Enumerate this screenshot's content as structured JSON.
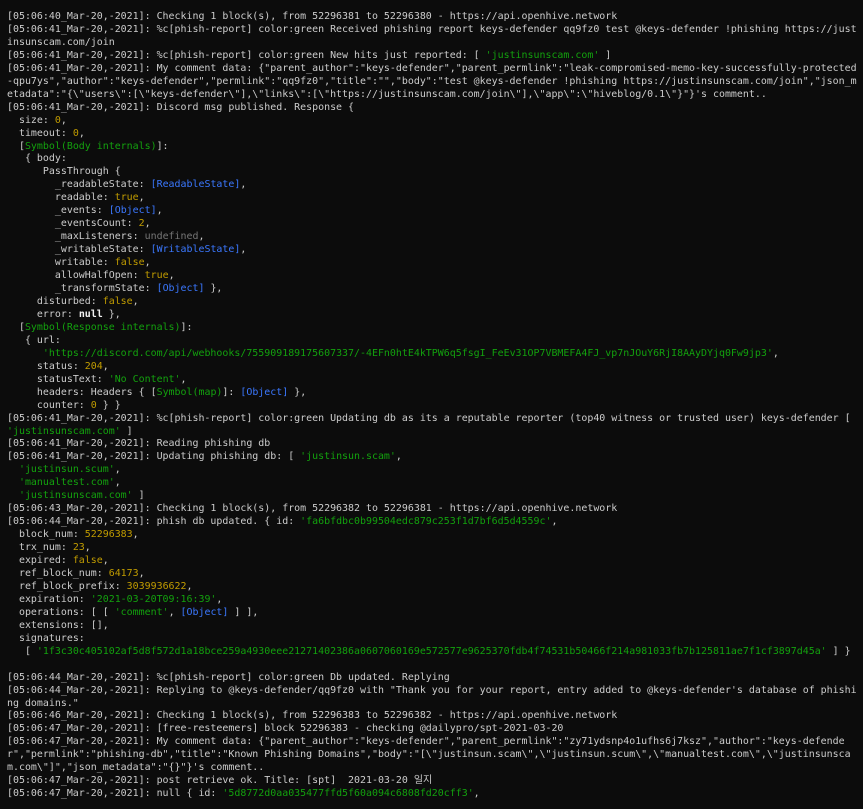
{
  "window": {
    "type": "terminal"
  },
  "colors": {
    "background": "#0c0c0c",
    "default": "#cccccc",
    "string": "#13a10e",
    "number": "#c19c00",
    "special": "#3b78ff",
    "symbol_ref": "#61d6d6",
    "bold": "#f2f2f2",
    "undefined": "#767676"
  },
  "lines": [
    [
      {
        "t": "[05:06:40_Mar-20,-2021]: Checking 1 block(s), from 52296381 to 52296380 - https://api.openhive.network",
        "c": "d"
      }
    ],
    [
      {
        "t": "[05:06:41_Mar-20,-2021]: %c[phish-report] color:green Received phishing report keys-defender qq9fz0 test @keys-defender !phishing https://justinsunscam.com/join",
        "c": "d"
      }
    ],
    [
      {
        "t": "[05:06:41_Mar-20,-2021]: %c[phish-report] color:green New hits just reported: [ ",
        "c": "d"
      },
      {
        "t": "'justinsunscam.com'",
        "c": "g"
      },
      {
        "t": " ]",
        "c": "d"
      }
    ],
    [
      {
        "t": "[05:06:41_Mar-20,-2021]: My comment data: {\"parent_author\":\"keys-defender\",\"parent_permlink\":\"leak-compromised-memo-key-successfully-protected-qpu7ys\",\"author\":\"keys-defender\",\"permlink\":\"qq9fz0\",\"title\":\"\",\"body\":\"test @keys-defender !phishing https://justinsunscam.com/join\",\"json_metadata\":\"{\\\"users\\\":[\\\"keys-defender\\\"],\\\"links\\\":[\\\"https://justinsunscam.com/join\\\"],\\\"app\\\":\\\"hiveblog/0.1\\\"}\"}'s comment..",
        "c": "d"
      }
    ],
    [
      {
        "t": "[05:06:41_Mar-20,-2021]: Discord msg published. Response {",
        "c": "d"
      }
    ],
    [
      {
        "t": "  size: ",
        "c": "d"
      },
      {
        "t": "0",
        "c": "y"
      },
      {
        "t": ",",
        "c": "d"
      }
    ],
    [
      {
        "t": "  timeout: ",
        "c": "d"
      },
      {
        "t": "0",
        "c": "y"
      },
      {
        "t": ",",
        "c": "d"
      }
    ],
    [
      {
        "t": "  [",
        "c": "d"
      },
      {
        "t": "Symbol(Body internals)",
        "c": "g"
      },
      {
        "t": "]:",
        "c": "d"
      }
    ],
    [
      {
        "t": "   { body:",
        "c": "d"
      }
    ],
    [
      {
        "t": "      PassThrough {",
        "c": "d"
      }
    ],
    [
      {
        "t": "        _readableState: ",
        "c": "d"
      },
      {
        "t": "[ReadableState]",
        "c": "c"
      },
      {
        "t": ",",
        "c": "d"
      }
    ],
    [
      {
        "t": "        readable: ",
        "c": "d"
      },
      {
        "t": "true",
        "c": "y"
      },
      {
        "t": ",",
        "c": "d"
      }
    ],
    [
      {
        "t": "        _events: ",
        "c": "d"
      },
      {
        "t": "[Object]",
        "c": "c"
      },
      {
        "t": ",",
        "c": "d"
      }
    ],
    [
      {
        "t": "        _eventsCount: ",
        "c": "d"
      },
      {
        "t": "2",
        "c": "y"
      },
      {
        "t": ",",
        "c": "d"
      }
    ],
    [
      {
        "t": "        _maxListeners: ",
        "c": "d"
      },
      {
        "t": "undefined",
        "c": "u"
      },
      {
        "t": ",",
        "c": "d"
      }
    ],
    [
      {
        "t": "        _writableState: ",
        "c": "d"
      },
      {
        "t": "[WritableState]",
        "c": "c"
      },
      {
        "t": ",",
        "c": "d"
      }
    ],
    [
      {
        "t": "        writable: ",
        "c": "d"
      },
      {
        "t": "false",
        "c": "y"
      },
      {
        "t": ",",
        "c": "d"
      }
    ],
    [
      {
        "t": "        allowHalfOpen: ",
        "c": "d"
      },
      {
        "t": "true",
        "c": "y"
      },
      {
        "t": ",",
        "c": "d"
      }
    ],
    [
      {
        "t": "        _transformState: ",
        "c": "d"
      },
      {
        "t": "[Object]",
        "c": "c"
      },
      {
        "t": " },",
        "c": "d"
      }
    ],
    [
      {
        "t": "     disturbed: ",
        "c": "d"
      },
      {
        "t": "false",
        "c": "y"
      },
      {
        "t": ",",
        "c": "d"
      }
    ],
    [
      {
        "t": "     error: ",
        "c": "d"
      },
      {
        "t": "null",
        "c": "b"
      },
      {
        "t": " },",
        "c": "d"
      }
    ],
    [
      {
        "t": "  [",
        "c": "d"
      },
      {
        "t": "Symbol(Response internals)",
        "c": "g"
      },
      {
        "t": "]:",
        "c": "d"
      }
    ],
    [
      {
        "t": "   { url:",
        "c": "d"
      }
    ],
    [
      {
        "t": "      ",
        "c": "d"
      },
      {
        "t": "'https://discord.com/api/webhooks/755909189175607337/-4EFn0htE4kTPW6q5fsgI_FeEv31OP7VBMEFA4FJ_vp7nJOuY6RjI8AAyDYjq0Fw9jp3'",
        "c": "g"
      },
      {
        "t": ",",
        "c": "d"
      }
    ],
    [
      {
        "t": "     status: ",
        "c": "d"
      },
      {
        "t": "204",
        "c": "y"
      },
      {
        "t": ",",
        "c": "d"
      }
    ],
    [
      {
        "t": "     statusText: ",
        "c": "d"
      },
      {
        "t": "'No Content'",
        "c": "g"
      },
      {
        "t": ",",
        "c": "d"
      }
    ],
    [
      {
        "t": "     headers: Headers { [",
        "c": "d"
      },
      {
        "t": "Symbol(map)",
        "c": "g"
      },
      {
        "t": "]: ",
        "c": "d"
      },
      {
        "t": "[Object]",
        "c": "c"
      },
      {
        "t": " },",
        "c": "d"
      }
    ],
    [
      {
        "t": "     counter: ",
        "c": "d"
      },
      {
        "t": "0",
        "c": "y"
      },
      {
        "t": " } }",
        "c": "d"
      }
    ],
    [
      {
        "t": "[05:06:41_Mar-20,-2021]: %c[phish-report] color:green Updating db as its a reputable reporter (top40 witness or trusted user) keys-defender [ ",
        "c": "d"
      },
      {
        "t": "'justinsunscam.com'",
        "c": "g"
      },
      {
        "t": " ]",
        "c": "d"
      }
    ],
    [
      {
        "t": "[05:06:41_Mar-20,-2021]: Reading phishing db",
        "c": "d"
      }
    ],
    [
      {
        "t": "[05:06:41_Mar-20,-2021]: Updating phishing db: [ ",
        "c": "d"
      },
      {
        "t": "'justinsun.scam'",
        "c": "g"
      },
      {
        "t": ",",
        "c": "d"
      }
    ],
    [
      {
        "t": "  ",
        "c": "d"
      },
      {
        "t": "'justinsun.scum'",
        "c": "g"
      },
      {
        "t": ",",
        "c": "d"
      }
    ],
    [
      {
        "t": "  ",
        "c": "d"
      },
      {
        "t": "'manualtest.com'",
        "c": "g"
      },
      {
        "t": ",",
        "c": "d"
      }
    ],
    [
      {
        "t": "  ",
        "c": "d"
      },
      {
        "t": "'justinsunscam.com'",
        "c": "g"
      },
      {
        "t": " ]",
        "c": "d"
      }
    ],
    [
      {
        "t": "[05:06:43_Mar-20,-2021]: Checking 1 block(s), from 52296382 to 52296381 - https://api.openhive.network",
        "c": "d"
      }
    ],
    [
      {
        "t": "[05:06:44_Mar-20,-2021]: phish db updated. { id: ",
        "c": "d"
      },
      {
        "t": "'fa6bfdbc0b99504edc879c253f1d7bf6d5d4559c'",
        "c": "g"
      },
      {
        "t": ",",
        "c": "d"
      }
    ],
    [
      {
        "t": "  block_num: ",
        "c": "d"
      },
      {
        "t": "52296383",
        "c": "y"
      },
      {
        "t": ",",
        "c": "d"
      }
    ],
    [
      {
        "t": "  trx_num: ",
        "c": "d"
      },
      {
        "t": "23",
        "c": "y"
      },
      {
        "t": ",",
        "c": "d"
      }
    ],
    [
      {
        "t": "  expired: ",
        "c": "d"
      },
      {
        "t": "false",
        "c": "y"
      },
      {
        "t": ",",
        "c": "d"
      }
    ],
    [
      {
        "t": "  ref_block_num: ",
        "c": "d"
      },
      {
        "t": "64173",
        "c": "y"
      },
      {
        "t": ",",
        "c": "d"
      }
    ],
    [
      {
        "t": "  ref_block_prefix: ",
        "c": "d"
      },
      {
        "t": "3039936622",
        "c": "y"
      },
      {
        "t": ",",
        "c": "d"
      }
    ],
    [
      {
        "t": "  expiration: ",
        "c": "d"
      },
      {
        "t": "'2021-03-20T09:16:39'",
        "c": "g"
      },
      {
        "t": ",",
        "c": "d"
      }
    ],
    [
      {
        "t": "  operations: [ [ ",
        "c": "d"
      },
      {
        "t": "'comment'",
        "c": "g"
      },
      {
        "t": ", ",
        "c": "d"
      },
      {
        "t": "[Object]",
        "c": "c"
      },
      {
        "t": " ] ],",
        "c": "d"
      }
    ],
    [
      {
        "t": "  extensions: [],",
        "c": "d"
      }
    ],
    [
      {
        "t": "  signatures:",
        "c": "d"
      }
    ],
    [
      {
        "t": "   [ ",
        "c": "d"
      },
      {
        "t": "'1f3c30c405102af5d8f572d1a18bce259a4930eee21271402386a0607060169e572577e9625370fdb4f74531b50466f214a981033fb7b125811ae7f1cf3897d45a'",
        "c": "g"
      },
      {
        "t": " ] }",
        "c": "d"
      }
    ],
    [
      {
        "t": "",
        "c": "d"
      }
    ],
    [
      {
        "t": "[05:06:44_Mar-20,-2021]: %c[phish-report] color:green Db updated. Replying",
        "c": "d"
      }
    ],
    [
      {
        "t": "[05:06:44_Mar-20,-2021]: Replying to @keys-defender/qq9fz0 with \"Thank you for your report, entry added to @keys-defender's database of phishing domains.\"",
        "c": "d"
      }
    ],
    [
      {
        "t": "[05:06:46_Mar-20,-2021]: Checking 1 block(s), from 52296383 to 52296382 - https://api.openhive.network",
        "c": "d"
      }
    ],
    [
      {
        "t": "[05:06:47_Mar-20,-2021]: [free-resteemers] block 52296383 - checking @dailypro/spt-2021-03-20",
        "c": "d"
      }
    ],
    [
      {
        "t": "[05:06:47_Mar-20,-2021]: My comment data: {\"parent_author\":\"keys-defender\",\"parent_permlink\":\"zy71ydsnp4o1ufhs6j7ksz\",\"author\":\"keys-defender\",\"permlink\":\"phishing-db\",\"title\":\"Known Phishing Domains\",\"body\":\"[\\\"justinsun.scam\\\",\\\"justinsun.scum\\\",\\\"manualtest.com\\\",\\\"justinsunscam.com\\\"]\",\"json_metadata\":\"{}\"}'s comment..",
        "c": "d"
      }
    ],
    [
      {
        "t": "[05:06:47_Mar-20,-2021]: post retrieve ok. Title: [spt]  2021-03-20 일지",
        "c": "d"
      }
    ],
    [
      {
        "t": "[05:06:47_Mar-20,-2021]: null { id: ",
        "c": "d"
      },
      {
        "t": "'5d8772d0aa035477ffd5f60a094c6808fd20cff3'",
        "c": "g"
      },
      {
        "t": ",",
        "c": "d"
      }
    ]
  ]
}
